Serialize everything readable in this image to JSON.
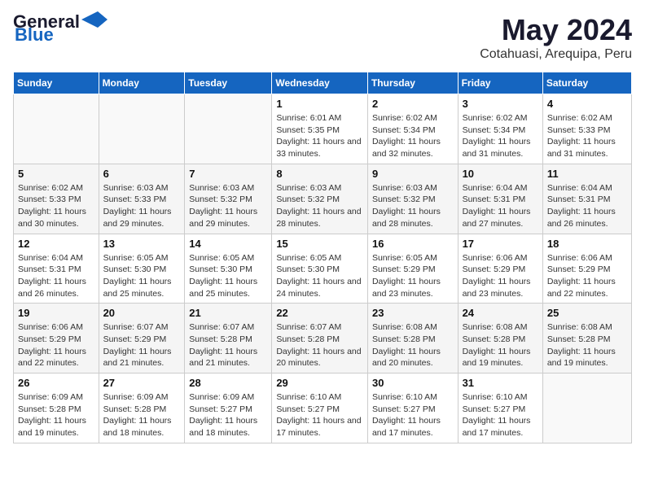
{
  "header": {
    "logo_general": "General",
    "logo_blue": "Blue",
    "main_title": "May 2024",
    "subtitle": "Cotahuasi, Arequipa, Peru"
  },
  "calendar": {
    "days_of_week": [
      "Sunday",
      "Monday",
      "Tuesday",
      "Wednesday",
      "Thursday",
      "Friday",
      "Saturday"
    ],
    "weeks": [
      [
        {
          "day": "",
          "info": ""
        },
        {
          "day": "",
          "info": ""
        },
        {
          "day": "",
          "info": ""
        },
        {
          "day": "1",
          "info": "Sunrise: 6:01 AM\nSunset: 5:35 PM\nDaylight: 11 hours and 33 minutes."
        },
        {
          "day": "2",
          "info": "Sunrise: 6:02 AM\nSunset: 5:34 PM\nDaylight: 11 hours and 32 minutes."
        },
        {
          "day": "3",
          "info": "Sunrise: 6:02 AM\nSunset: 5:34 PM\nDaylight: 11 hours and 31 minutes."
        },
        {
          "day": "4",
          "info": "Sunrise: 6:02 AM\nSunset: 5:33 PM\nDaylight: 11 hours and 31 minutes."
        }
      ],
      [
        {
          "day": "5",
          "info": "Sunrise: 6:02 AM\nSunset: 5:33 PM\nDaylight: 11 hours and 30 minutes."
        },
        {
          "day": "6",
          "info": "Sunrise: 6:03 AM\nSunset: 5:33 PM\nDaylight: 11 hours and 29 minutes."
        },
        {
          "day": "7",
          "info": "Sunrise: 6:03 AM\nSunset: 5:32 PM\nDaylight: 11 hours and 29 minutes."
        },
        {
          "day": "8",
          "info": "Sunrise: 6:03 AM\nSunset: 5:32 PM\nDaylight: 11 hours and 28 minutes."
        },
        {
          "day": "9",
          "info": "Sunrise: 6:03 AM\nSunset: 5:32 PM\nDaylight: 11 hours and 28 minutes."
        },
        {
          "day": "10",
          "info": "Sunrise: 6:04 AM\nSunset: 5:31 PM\nDaylight: 11 hours and 27 minutes."
        },
        {
          "day": "11",
          "info": "Sunrise: 6:04 AM\nSunset: 5:31 PM\nDaylight: 11 hours and 26 minutes."
        }
      ],
      [
        {
          "day": "12",
          "info": "Sunrise: 6:04 AM\nSunset: 5:31 PM\nDaylight: 11 hours and 26 minutes."
        },
        {
          "day": "13",
          "info": "Sunrise: 6:05 AM\nSunset: 5:30 PM\nDaylight: 11 hours and 25 minutes."
        },
        {
          "day": "14",
          "info": "Sunrise: 6:05 AM\nSunset: 5:30 PM\nDaylight: 11 hours and 25 minutes."
        },
        {
          "day": "15",
          "info": "Sunrise: 6:05 AM\nSunset: 5:30 PM\nDaylight: 11 hours and 24 minutes."
        },
        {
          "day": "16",
          "info": "Sunrise: 6:05 AM\nSunset: 5:29 PM\nDaylight: 11 hours and 23 minutes."
        },
        {
          "day": "17",
          "info": "Sunrise: 6:06 AM\nSunset: 5:29 PM\nDaylight: 11 hours and 23 minutes."
        },
        {
          "day": "18",
          "info": "Sunrise: 6:06 AM\nSunset: 5:29 PM\nDaylight: 11 hours and 22 minutes."
        }
      ],
      [
        {
          "day": "19",
          "info": "Sunrise: 6:06 AM\nSunset: 5:29 PM\nDaylight: 11 hours and 22 minutes."
        },
        {
          "day": "20",
          "info": "Sunrise: 6:07 AM\nSunset: 5:29 PM\nDaylight: 11 hours and 21 minutes."
        },
        {
          "day": "21",
          "info": "Sunrise: 6:07 AM\nSunset: 5:28 PM\nDaylight: 11 hours and 21 minutes."
        },
        {
          "day": "22",
          "info": "Sunrise: 6:07 AM\nSunset: 5:28 PM\nDaylight: 11 hours and 20 minutes."
        },
        {
          "day": "23",
          "info": "Sunrise: 6:08 AM\nSunset: 5:28 PM\nDaylight: 11 hours and 20 minutes."
        },
        {
          "day": "24",
          "info": "Sunrise: 6:08 AM\nSunset: 5:28 PM\nDaylight: 11 hours and 19 minutes."
        },
        {
          "day": "25",
          "info": "Sunrise: 6:08 AM\nSunset: 5:28 PM\nDaylight: 11 hours and 19 minutes."
        }
      ],
      [
        {
          "day": "26",
          "info": "Sunrise: 6:09 AM\nSunset: 5:28 PM\nDaylight: 11 hours and 19 minutes."
        },
        {
          "day": "27",
          "info": "Sunrise: 6:09 AM\nSunset: 5:28 PM\nDaylight: 11 hours and 18 minutes."
        },
        {
          "day": "28",
          "info": "Sunrise: 6:09 AM\nSunset: 5:27 PM\nDaylight: 11 hours and 18 minutes."
        },
        {
          "day": "29",
          "info": "Sunrise: 6:10 AM\nSunset: 5:27 PM\nDaylight: 11 hours and 17 minutes."
        },
        {
          "day": "30",
          "info": "Sunrise: 6:10 AM\nSunset: 5:27 PM\nDaylight: 11 hours and 17 minutes."
        },
        {
          "day": "31",
          "info": "Sunrise: 6:10 AM\nSunset: 5:27 PM\nDaylight: 11 hours and 17 minutes."
        },
        {
          "day": "",
          "info": ""
        }
      ]
    ]
  }
}
